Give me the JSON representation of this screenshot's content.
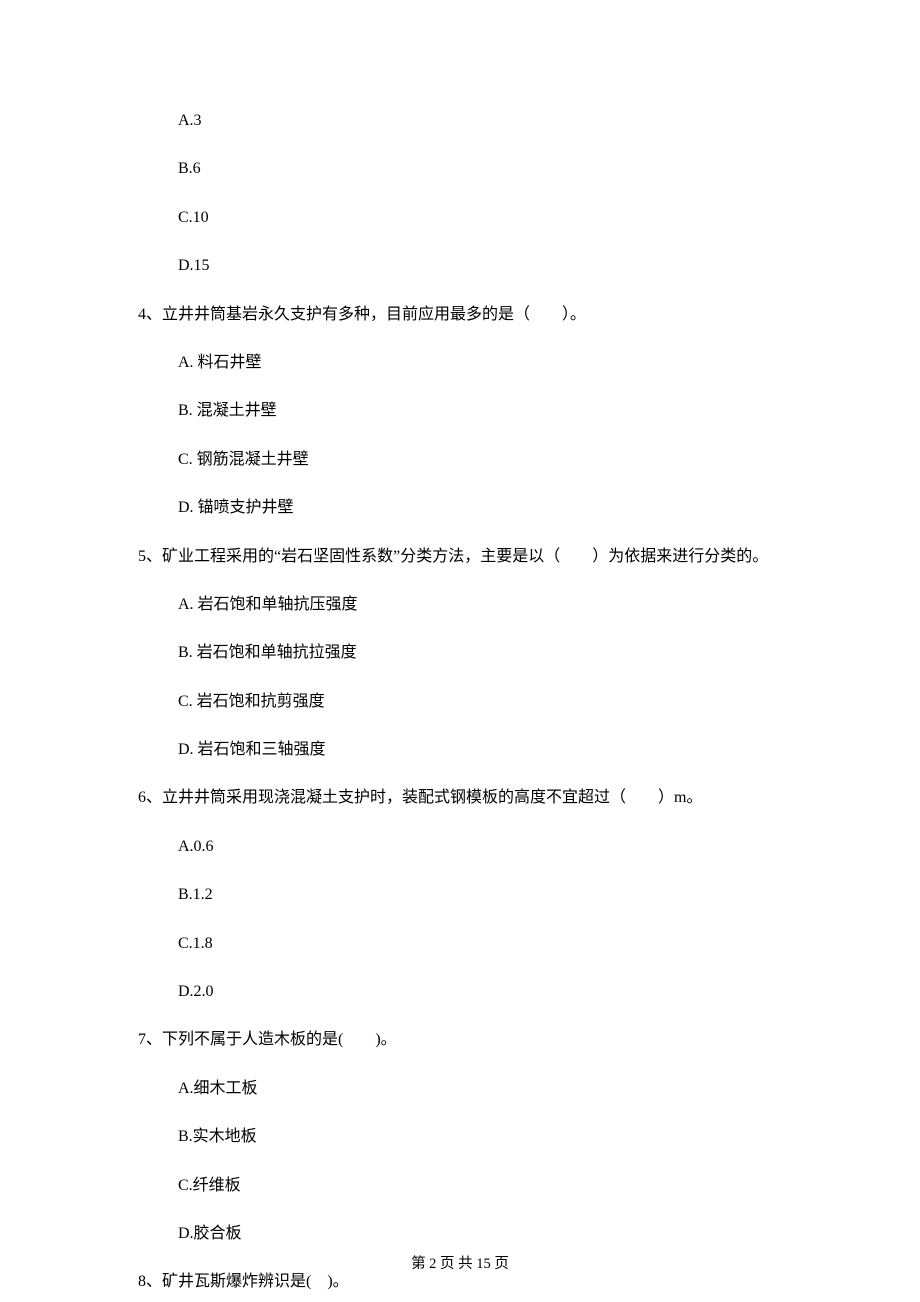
{
  "q3": {
    "options": {
      "a": "A.3",
      "b": "B.6",
      "c": "C.10",
      "d": "D.15"
    }
  },
  "q4": {
    "text": "4、立井井筒基岩永久支护有多种，目前应用最多的是（　　）。",
    "options": {
      "a": "A. 料石井壁",
      "b": "B. 混凝土井壁",
      "c": "C. 钢筋混凝土井壁",
      "d": "D. 锚喷支护井壁"
    }
  },
  "q5": {
    "text": "5、矿业工程采用的“岩石坚固性系数”分类方法，主要是以（　　）为依据来进行分类的。",
    "options": {
      "a": "A. 岩石饱和单轴抗压强度",
      "b": "B. 岩石饱和单轴抗拉强度",
      "c": "C. 岩石饱和抗剪强度",
      "d": "D. 岩石饱和三轴强度"
    }
  },
  "q6": {
    "text": "6、立井井筒采用现浇混凝土支护时，装配式钢模板的高度不宜超过（　　）m。",
    "options": {
      "a": "A.0.6",
      "b": "B.1.2",
      "c": "C.1.8",
      "d": "D.2.0"
    }
  },
  "q7": {
    "text": "7、下列不属于人造木板的是(　　)。",
    "options": {
      "a": "A.细木工板",
      "b": "B.实木地板",
      "c": "C.纤维板",
      "d": "D.胶合板"
    }
  },
  "q8": {
    "text": "8、矿井瓦斯爆炸辨识是(　)。"
  },
  "footer": "第 2 页 共 15 页"
}
